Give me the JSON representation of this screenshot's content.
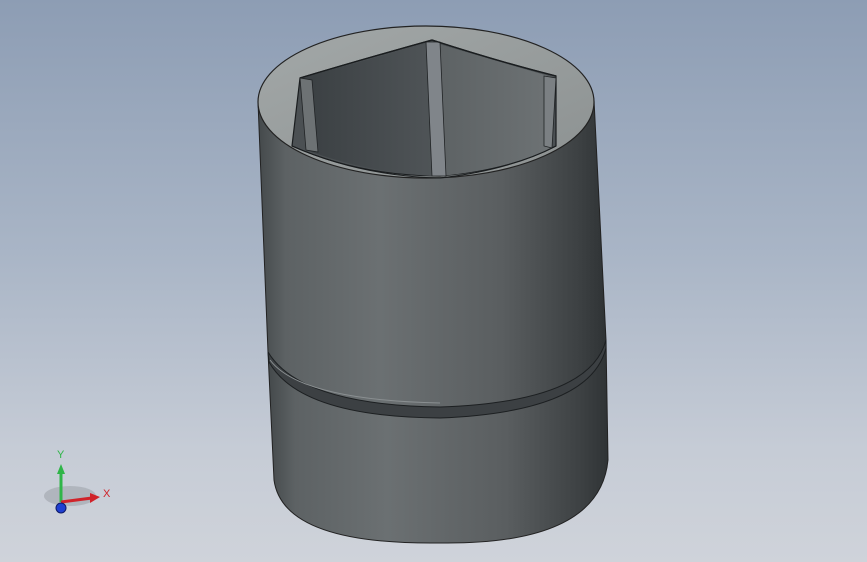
{
  "viewport": {
    "background_top": "#8d9db4",
    "background_bottom": "#cfd3da"
  },
  "model": {
    "shape": "hex-socket",
    "body_color": "#5b5f61",
    "rim_color": "#9ea3a3"
  },
  "triad": {
    "x_label": "X",
    "y_label": "Y",
    "x_color": "#d0232a",
    "y_color": "#2fb548",
    "z_color": "#1f3fd1"
  }
}
